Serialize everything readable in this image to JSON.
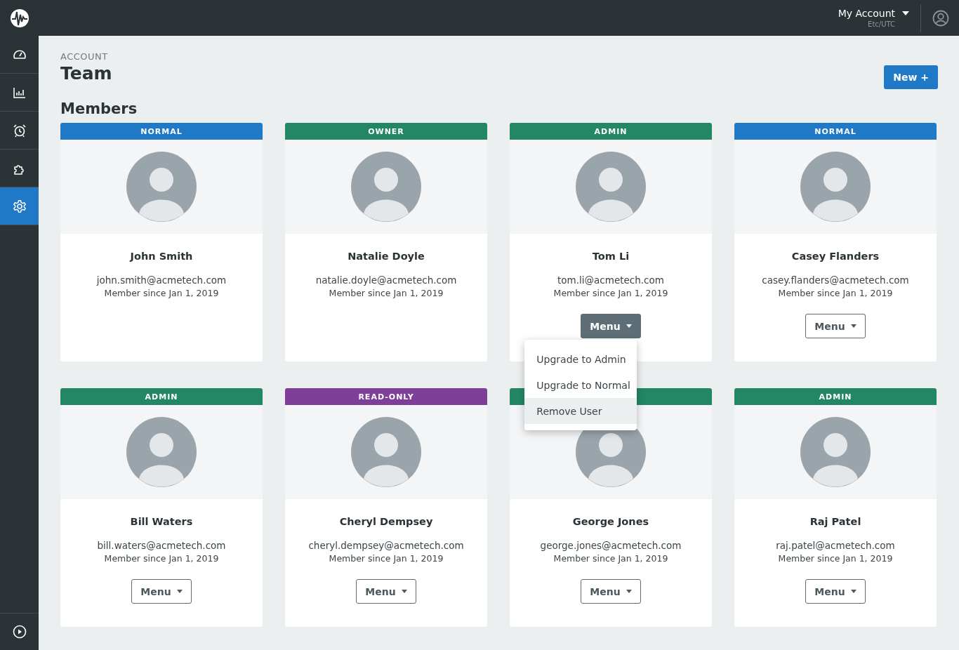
{
  "topbar": {
    "account": "My Account",
    "timezone": "Etc/UTC"
  },
  "sidebar": {
    "items": [
      {
        "kind": "dashboard",
        "selected": false
      },
      {
        "kind": "chart",
        "selected": false
      },
      {
        "kind": "alarm",
        "selected": false
      },
      {
        "kind": "puzzle",
        "selected": false
      },
      {
        "kind": "settings",
        "selected": true
      }
    ]
  },
  "header": {
    "breadcrumb": "ACCOUNT",
    "title": "Team",
    "new_button": "New +"
  },
  "section_title": "Members",
  "members": [
    {
      "role": "NORMAL",
      "color": "#2079c7",
      "name": "John Smith",
      "email": "john.smith@acmetech.com",
      "since": "Member since Jan 1, 2019"
    },
    {
      "role": "OWNER",
      "color": "#238766",
      "name": "Natalie Doyle",
      "email": "natalie.doyle@acmetech.com",
      "since": "Member since Jan 1, 2019"
    },
    {
      "role": "ADMIN",
      "color": "#238766",
      "name": "Tom Li",
      "email": "tom.li@acmetech.com",
      "since": "Member since Jan 1, 2019",
      "menu": {
        "label": "Menu",
        "open": true,
        "items": [
          {
            "label": "Upgrade to Admin",
            "selected": false
          },
          {
            "label": "Upgrade to Normal",
            "selected": false
          },
          {
            "label": "Remove User",
            "selected": true
          }
        ]
      }
    },
    {
      "role": "NORMAL",
      "color": "#2079c7",
      "name": "Casey Flanders",
      "email": "casey.flanders@acmetech.com",
      "since": "Member since Jan 1, 2019",
      "menu": {
        "label": "Menu",
        "open": false
      }
    },
    {
      "role": "ADMIN",
      "color": "#238766",
      "name": "Bill Waters",
      "email": "bill.waters@acmetech.com",
      "since": "Member since Jan 1, 2019",
      "menu": {
        "label": "Menu",
        "open": false
      }
    },
    {
      "role": "READ-ONLY",
      "color": "#7e3f98",
      "name": "Cheryl Dempsey",
      "email": "cheryl.dempsey@acmetech.com",
      "since": "Member since Jan 1, 2019",
      "menu": {
        "label": "Menu",
        "open": false
      }
    },
    {
      "color": "#238766",
      "name": "George Jones",
      "email": "george.jones@acmetech.com",
      "since": "Member since Jan 1, 2019",
      "menu": {
        "label": "Menu",
        "open": false
      }
    },
    {
      "role": "ADMIN",
      "color": "#238766",
      "name": "Raj Patel",
      "email": "raj.patel@acmetech.com",
      "since": "Member since Jan 1, 2019",
      "menu": {
        "label": "Menu",
        "open": false
      }
    }
  ]
}
